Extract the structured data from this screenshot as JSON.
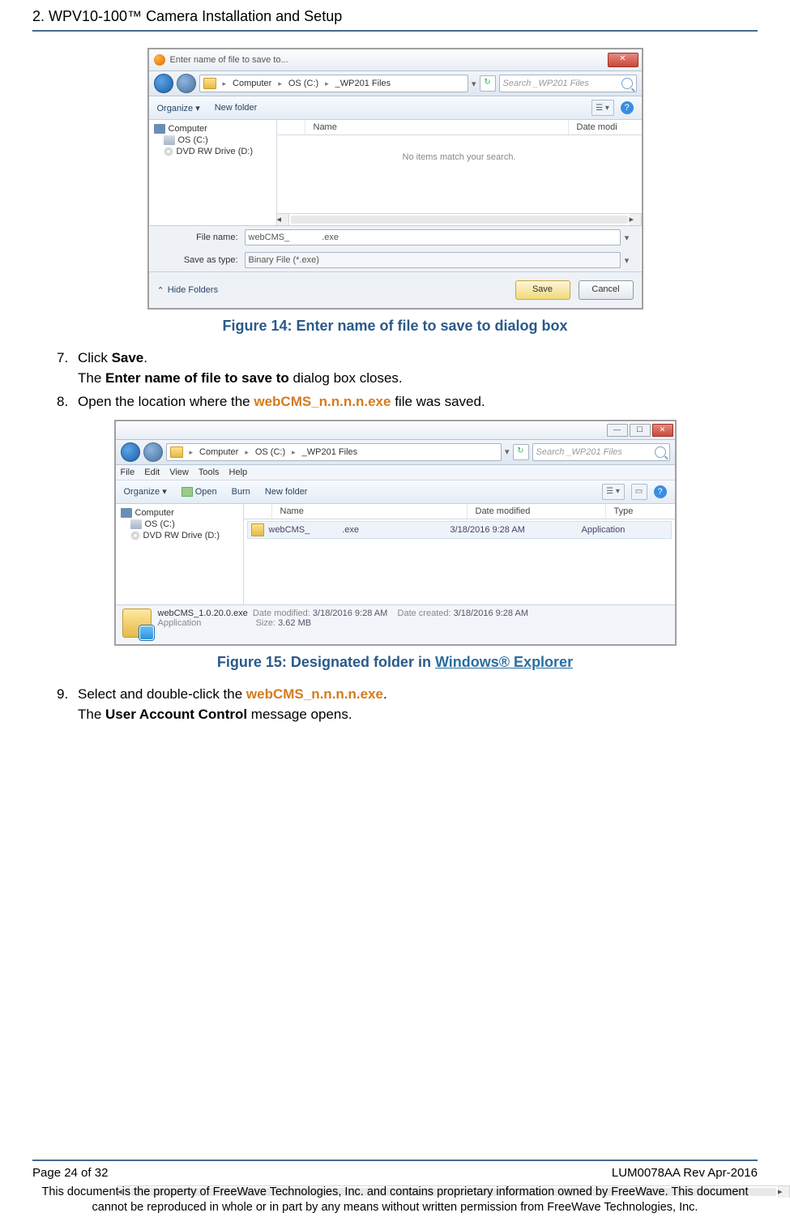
{
  "header": "2.  WPV10-100™ Camera Installation and Setup",
  "dialog1": {
    "title": "Enter name of file to save to...",
    "breadcrumb": [
      "Computer",
      "OS (C:)",
      "_WP201 Files"
    ],
    "search_placeholder": "Search _WP201 Files",
    "toolbar": {
      "organize": "Organize ▾",
      "newfolder": "New folder"
    },
    "columns": {
      "name": "Name",
      "date": "Date modi"
    },
    "tree": {
      "computer": "Computer",
      "os": "OS (C:)",
      "dvd": "DVD RW Drive (D:)"
    },
    "empty_msg": "No items match your search.",
    "file_label": "File name:",
    "file_value_a": "webCMS_",
    "file_value_b": ".exe",
    "type_label": "Save as type:",
    "type_value": "Binary File (*.exe)",
    "hide_folders": "Hide Folders",
    "save": "Save",
    "cancel": "Cancel"
  },
  "caption1": "Figure 14: Enter name of file to save to dialog box",
  "step7": {
    "num": "7.",
    "t1": "Click ",
    "b": "Save",
    "t2": ".",
    "sub_a": "The ",
    "sub_b": "Enter name of file to save to",
    "sub_c": " dialog box closes."
  },
  "step8": {
    "num": "8.",
    "t1": "Open the location where the ",
    "code": "webCMS_n.n.n.n.exe",
    "t2": " file was saved."
  },
  "dialog2": {
    "breadcrumb": [
      "Computer",
      "OS (C:)",
      "_WP201 Files"
    ],
    "search_placeholder": "Search _WP201 Files",
    "menus": [
      "File",
      "Edit",
      "View",
      "Tools",
      "Help"
    ],
    "toolbar": {
      "organize": "Organize ▾",
      "open": "Open",
      "burn": "Burn",
      "newfolder": "New folder"
    },
    "columns": {
      "name": "Name",
      "date": "Date modified",
      "type": "Type"
    },
    "tree": {
      "computer": "Computer",
      "os": "OS (C:)",
      "dvd": "DVD RW Drive (D:)"
    },
    "row": {
      "name_a": "webCMS_",
      "name_b": ".exe",
      "date": "3/18/2016 9:28 AM",
      "type": "Application"
    },
    "detail": {
      "name": "webCMS_1.0.20.0.exe",
      "sub": "Application",
      "dm_l": "Date modified:",
      "dm_v": "3/18/2016 9:28 AM",
      "sz_l": "Size:",
      "sz_v": "3.62 MB",
      "dc_l": "Date created:",
      "dc_v": "3/18/2016 9:28 AM"
    }
  },
  "caption2": {
    "a": "Figure 15: Designated folder in ",
    "b": "Windows® Explorer"
  },
  "step9": {
    "num": "9.",
    "t1": "Select and double-click the ",
    "code": "webCMS_n.n.n.n.exe",
    "t2": ".",
    "sub_a": "The ",
    "sub_b": "User Account Control",
    "sub_c": " message opens."
  },
  "footer": {
    "page": "Page 24 of 32",
    "rev": "LUM0078AA Rev Apr-2016",
    "legal": "This document is the property of FreeWave Technologies, Inc. and contains proprietary information owned by FreeWave. This document cannot be reproduced in whole or in part by any means without written permission from FreeWave Technologies, Inc."
  }
}
